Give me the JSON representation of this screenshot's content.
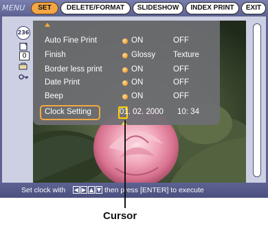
{
  "menu": {
    "label": "MENU",
    "tabs": [
      "SET",
      "DELETE/FORMAT",
      "SLIDESHOW",
      "INDEX PRINT",
      "EXIT"
    ],
    "active_tab": "SET"
  },
  "left_panel": {
    "count": "236",
    "quantity": "0"
  },
  "settings": {
    "rows": [
      {
        "label": "Auto Fine Print",
        "option1": "ON",
        "option2": "OFF"
      },
      {
        "label": "Finish",
        "option1": "Glossy",
        "option2": "Texture"
      },
      {
        "label": "Border less print",
        "option1": "ON",
        "option2": "OFF"
      },
      {
        "label": "Date Print",
        "option1": "ON",
        "option2": "OFF"
      },
      {
        "label": "Beep",
        "option1": "ON",
        "option2": "OFF"
      }
    ],
    "clock": {
      "label": "Clock Setting",
      "day": "01",
      "date_rest": ". 02. 2000",
      "time": "10: 34"
    }
  },
  "status": {
    "prefix": "Set clock with",
    "suffix": "then press [ENTER] to execute"
  },
  "callout": {
    "label": "Cursor"
  },
  "colors": {
    "accent": "#f2a940",
    "bar": "#5c6191",
    "frame": "#cdd0e3",
    "cursor": "#ffd400"
  }
}
